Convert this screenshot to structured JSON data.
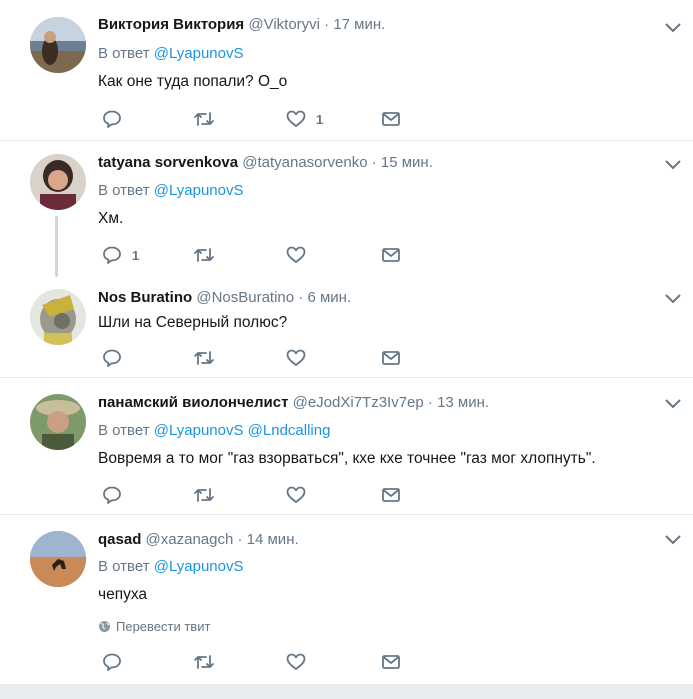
{
  "tweets": [
    {
      "name": "Виктория Виктория",
      "handle": "@Viktoryvi",
      "time": "· 17 мин.",
      "reply_prefix": "В ответ",
      "reply_links": [
        "@LyapunovS"
      ],
      "text": "Как оне туда попали? О_о",
      "reply_count": "",
      "retweet_count": "",
      "like_count": "1"
    },
    {
      "name": "tatyana sorvenkova",
      "handle": "@tatyanasorvenko",
      "time": "· 15 мин.",
      "reply_prefix": "В ответ",
      "reply_links": [
        "@LyapunovS"
      ],
      "text": "Хм.",
      "reply_count": "1",
      "retweet_count": "",
      "like_count": ""
    },
    {
      "name": "Nos Buratino",
      "handle": "@NosBuratino",
      "time": "· 6 мин.",
      "text": "Шли на Северный полюс?",
      "reply_count": "",
      "retweet_count": "",
      "like_count": ""
    },
    {
      "name": "панамский виолончелист",
      "handle": "@eJodXi7Tz3Iv7ep",
      "time": "· 13 мин.",
      "reply_prefix": "В ответ",
      "reply_links": [
        "@LyapunovS",
        "@Lndcalling"
      ],
      "text": "Вовремя а то мог \"газ взорваться\", кхе кхе точнее \"газ мог хлопнуть\".",
      "reply_count": "",
      "retweet_count": "",
      "like_count": ""
    },
    {
      "name": "qasad",
      "handle": "@xazanagch",
      "time": "· 14 мин.",
      "reply_prefix": "В ответ",
      "reply_links": [
        "@LyapunovS"
      ],
      "text": "чепуха",
      "translate_label": "Перевести твит",
      "reply_count": "",
      "retweet_count": "",
      "like_count": ""
    }
  ],
  "icons": {
    "reply": "reply-icon",
    "retweet": "retweet-icon",
    "like": "heart-icon",
    "message": "envelope-icon",
    "more": "chevron-down-icon",
    "translate": "globe-icon"
  },
  "colors": {
    "link": "#1b95e0",
    "secondary": "#657786",
    "separator": "#e6ecf0",
    "thread_line": "#ccd6dd"
  }
}
